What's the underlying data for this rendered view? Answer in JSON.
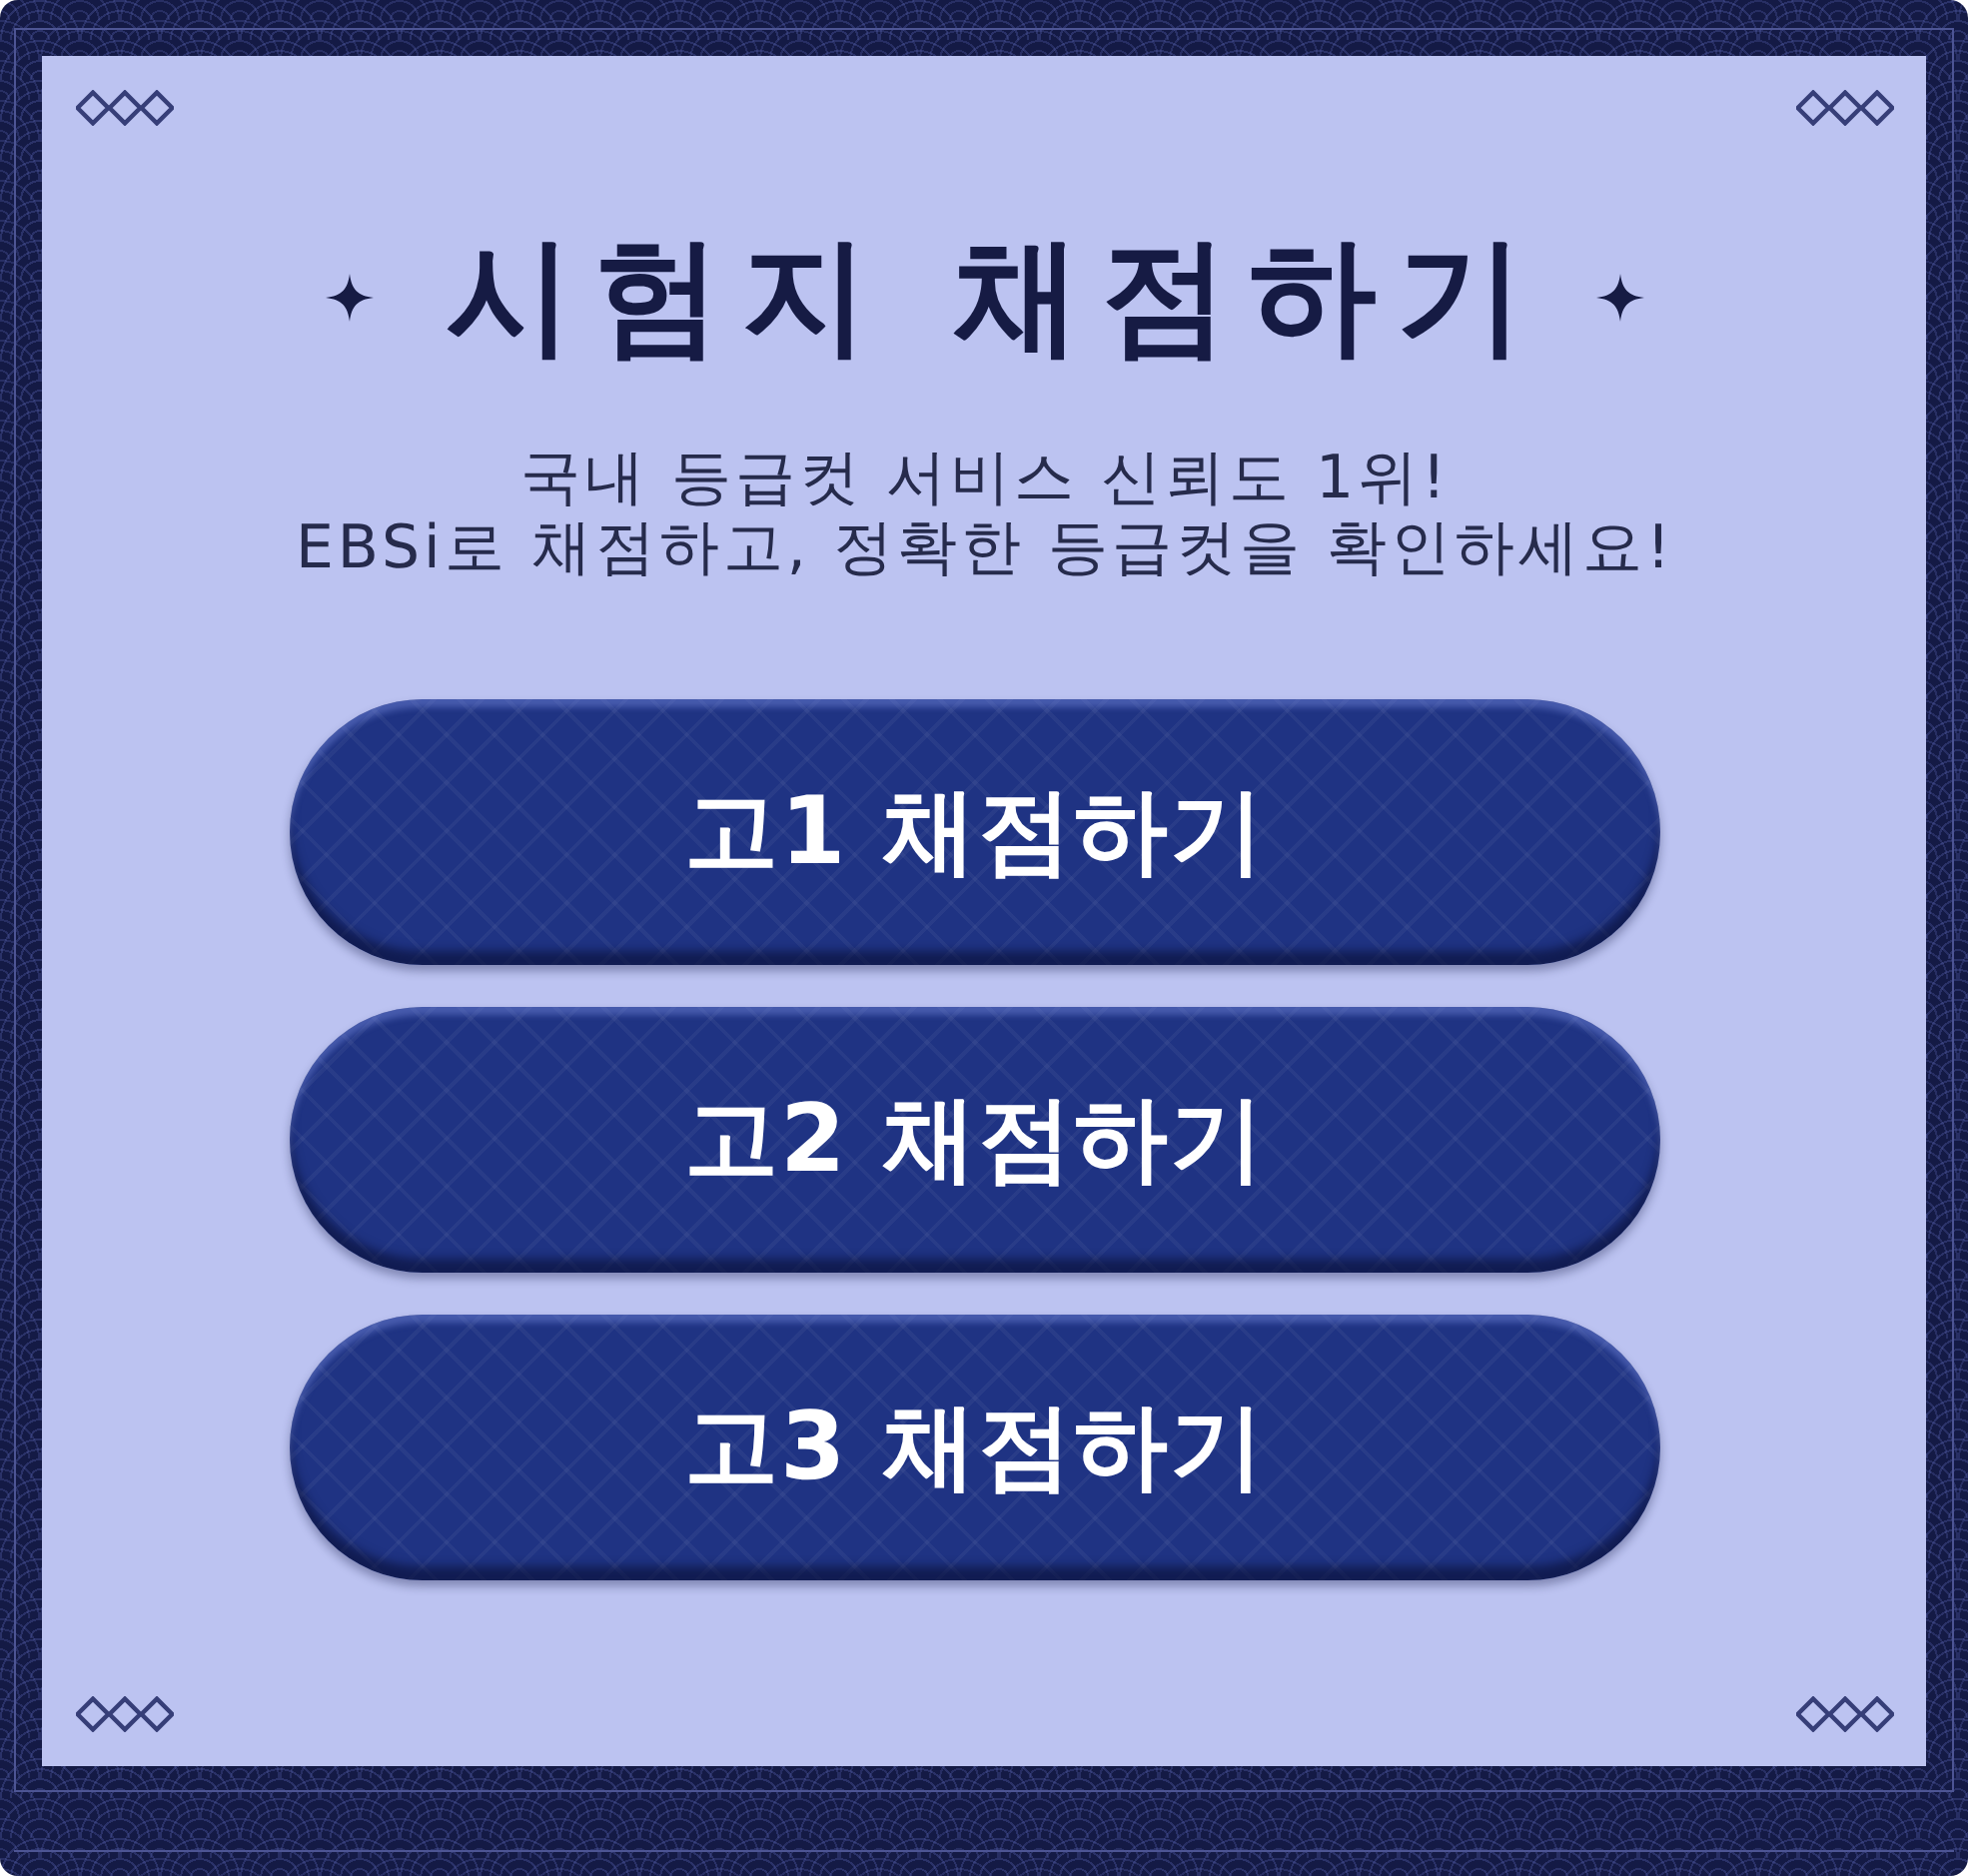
{
  "title": {
    "text": "시험지 채점하기"
  },
  "subtitle": [
    "국내 등급컷 서비스 신뢰도 1위!",
    "EBSi로 채점하고, 정확한 등급컷을 확인하세요!"
  ],
  "buttons": [
    {
      "label": "고1 채점하기"
    },
    {
      "label": "고2 채점하기"
    },
    {
      "label": "고3 채점하기"
    }
  ]
}
